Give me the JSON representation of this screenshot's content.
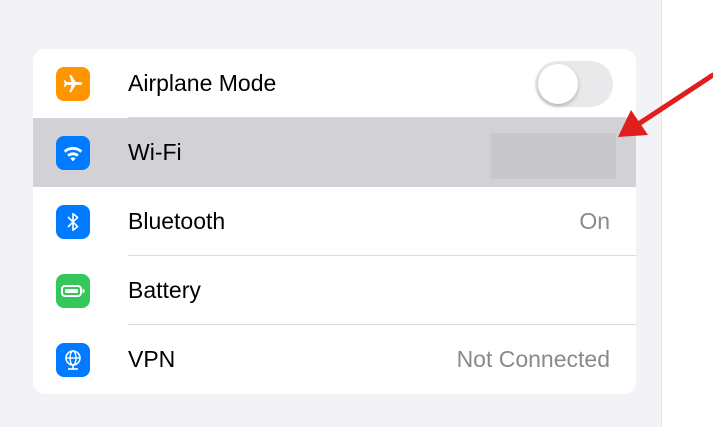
{
  "settings": {
    "rows": [
      {
        "label": "Airplane Mode",
        "value": "",
        "control": "toggle",
        "toggle_on": false,
        "icon": "airplane-icon",
        "icon_color": "#ff9500"
      },
      {
        "label": "Wi-Fi",
        "value": "",
        "control": "redacted",
        "selected": true,
        "icon": "wifi-icon",
        "icon_color": "#007aff"
      },
      {
        "label": "Bluetooth",
        "value": "On",
        "icon": "bluetooth-icon",
        "icon_color": "#007aff"
      },
      {
        "label": "Battery",
        "value": "",
        "icon": "battery-icon",
        "icon_color": "#34c759"
      },
      {
        "label": "VPN",
        "value": "Not Connected",
        "icon": "vpn-globe-icon",
        "icon_color": "#007aff"
      }
    ]
  },
  "annotation": {
    "type": "red-arrow",
    "color": "#e01e1e",
    "points_to": "Wi-Fi value"
  },
  "colors": {
    "background": "#f2f2f7",
    "selected_row": "#d1d1d6",
    "secondary_text": "#8a8a8e"
  }
}
